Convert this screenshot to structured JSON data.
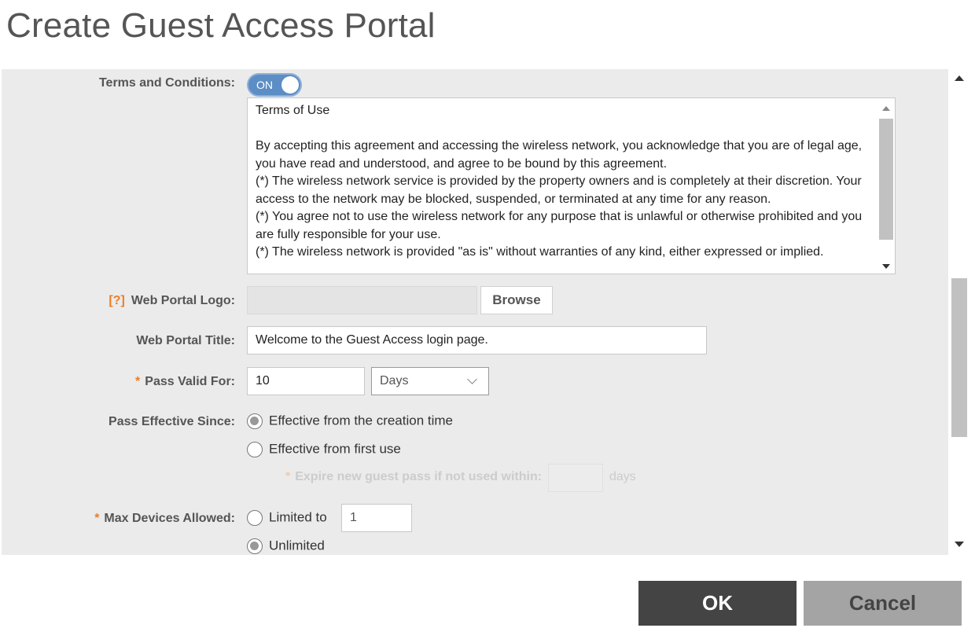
{
  "dialog": {
    "title": "Create Guest Access Portal"
  },
  "terms": {
    "label": "Terms and Conditions:",
    "toggle_text": "ON",
    "text": "Terms of Use\n\nBy accepting this agreement and accessing the wireless network, you acknowledge that you are of legal age, you have read and understood, and agree to be bound by this agreement.\n(*) The wireless network service is provided by the property owners and is completely at their discretion. Your access to the network may be blocked, suspended, or terminated at any time for any reason.\n(*) You agree not to use the wireless network for any purpose that is unlawful or otherwise prohibited and you are fully responsible for your use.\n(*) The wireless network is provided \"as is\" without warranties of any kind, either expressed or implied."
  },
  "logo": {
    "help": "[?]",
    "label": "Web Portal Logo:",
    "value": "",
    "browse_label": "Browse"
  },
  "portal_title": {
    "label": "Web Portal Title:",
    "value": "Welcome to the Guest Access login page."
  },
  "pass_valid": {
    "required_mark": "*",
    "label": "Pass Valid For:",
    "value": "10",
    "unit_selected": "Days"
  },
  "pass_effective": {
    "label": "Pass Effective Since:",
    "options": [
      {
        "label": "Effective from the creation time",
        "checked": true
      },
      {
        "label": "Effective from first use",
        "checked": false
      }
    ],
    "expire_required_mark": "*",
    "expire_label": "Expire new guest pass if not used within:",
    "expire_value": "",
    "expire_unit": "days"
  },
  "max_devices": {
    "required_mark": "*",
    "label": "Max Devices Allowed:",
    "limited_label": "Limited to",
    "limited_value": "1",
    "unlimited_label": "Unlimited",
    "selected": "Unlimited"
  },
  "buttons": {
    "ok_label": "OK",
    "cancel_label": "Cancel"
  },
  "colors": {
    "toggle_on": "#5c8dc5",
    "required": "#ef7d22",
    "ok_bg": "#444444",
    "cancel_bg": "#a4a4a4"
  }
}
